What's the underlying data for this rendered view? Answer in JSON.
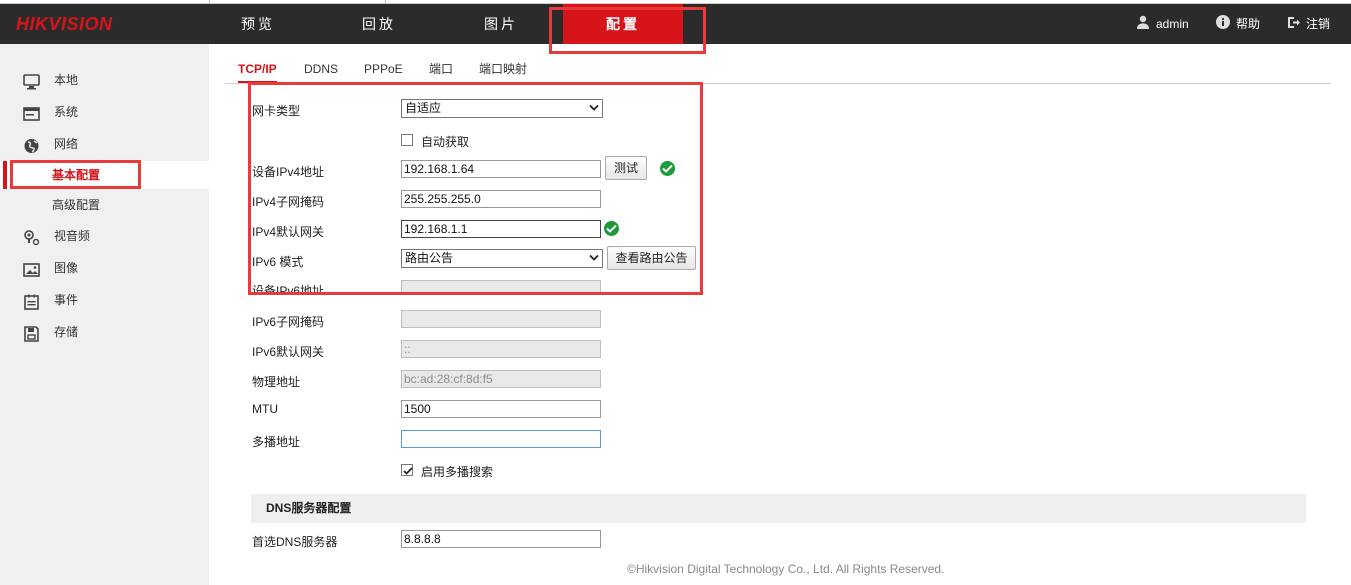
{
  "header": {
    "logo": "HIKVISION",
    "nav": [
      {
        "label": "预览"
      },
      {
        "label": "回放"
      },
      {
        "label": "图片"
      },
      {
        "label": "配置"
      }
    ],
    "user": "admin",
    "help": "帮助",
    "logout": "注销"
  },
  "sidebar": {
    "items": [
      {
        "label": "本地",
        "icon": "monitor-icon"
      },
      {
        "label": "系统",
        "icon": "system-icon"
      },
      {
        "label": "网络",
        "icon": "globe-icon"
      },
      {
        "label": "基本配置",
        "sub": true,
        "active": true
      },
      {
        "label": "高级配置",
        "sub": true
      },
      {
        "label": "视音频",
        "icon": "mic-icon"
      },
      {
        "label": "图像",
        "icon": "image-icon"
      },
      {
        "label": "事件",
        "icon": "event-icon"
      },
      {
        "label": "存储",
        "icon": "storage-icon"
      }
    ]
  },
  "tabs": [
    {
      "label": "TCP/IP",
      "active": true
    },
    {
      "label": "DDNS"
    },
    {
      "label": "PPPoE"
    },
    {
      "label": "端口"
    },
    {
      "label": "端口映射"
    }
  ],
  "form": {
    "nic_type_label": "网卡类型",
    "nic_type_value": "自适应",
    "dhcp_label": "自动获取",
    "dhcp_checked": false,
    "ipv4_label": "设备IPv4地址",
    "ipv4_value": "192.168.1.64",
    "test_button": "测试",
    "ipv4_mask_label": "IPv4子网掩码",
    "ipv4_mask_value": "255.255.255.0",
    "ipv4_gateway_label": "IPv4默认网关",
    "ipv4_gateway_value": "192.168.1.1",
    "ipv6_mode_label": "IPv6 模式",
    "ipv6_mode_value": "路由公告",
    "view_route_button": "查看路由公告",
    "ipv6_addr_label": "设备IPv6地址",
    "ipv6_addr_value": "",
    "ipv6_mask_label": "IPv6子网掩码",
    "ipv6_mask_value": "",
    "ipv6_gateway_label": "IPv6默认网关",
    "ipv6_gateway_value": "::",
    "mac_label": "物理地址",
    "mac_value": "bc:ad:28:cf:8d:f5",
    "mtu_label": "MTU",
    "mtu_value": "1500",
    "multicast_label": "多播地址",
    "multicast_value": "",
    "multicast_search_label": "启用多播搜索",
    "multicast_search_checked": true,
    "dns_section": "DNS服务器配置",
    "dns_primary_label": "首选DNS服务器",
    "dns_primary_value": "8.8.8.8"
  },
  "footer": "©Hikvision Digital Technology Co., Ltd. All Rights Reserved.",
  "colors": {
    "brand_red": "#d7141a",
    "header_bg": "#2b2b2b",
    "annotation_red": "#e83a3a",
    "ok_green": "#1a9a3a"
  }
}
